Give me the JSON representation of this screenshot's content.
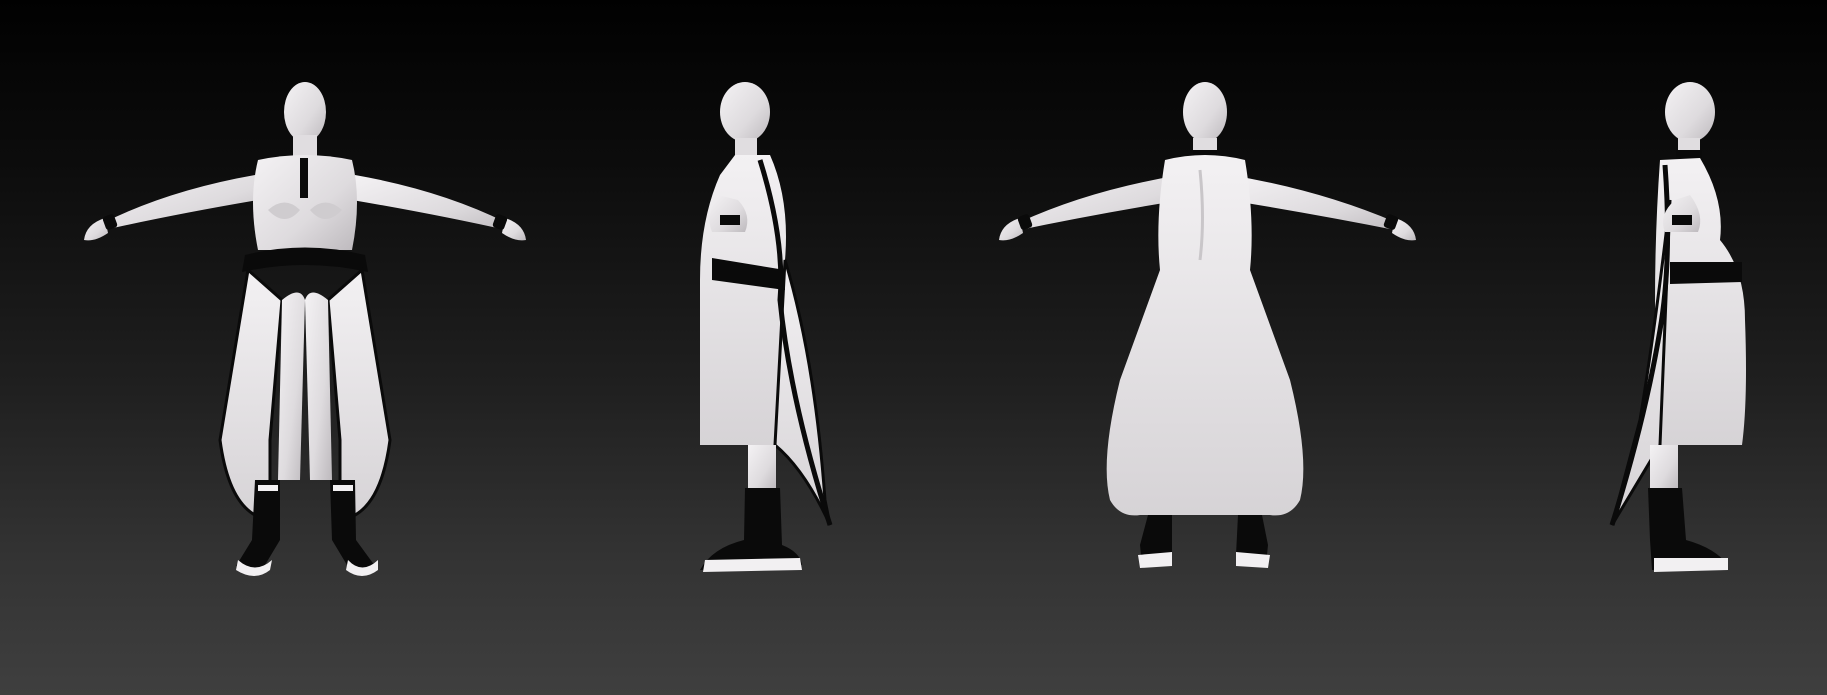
{
  "scene": {
    "background_top": "#010101",
    "background_bottom": "#3f3f3f",
    "clay_color": "#e6e3e6",
    "trim_color": "#0a0a0a",
    "views": [
      {
        "id": "front",
        "label": ""
      },
      {
        "id": "side-left",
        "label": ""
      },
      {
        "id": "back",
        "label": ""
      },
      {
        "id": "side-right",
        "label": ""
      }
    ]
  }
}
